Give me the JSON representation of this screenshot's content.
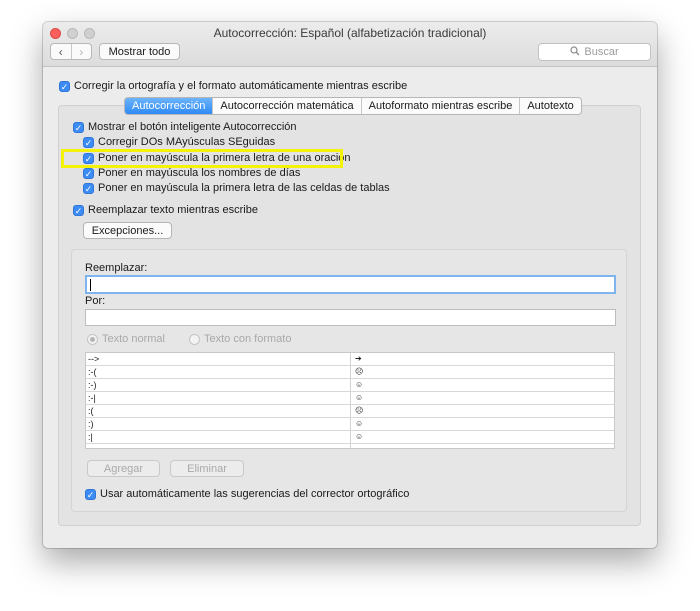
{
  "window": {
    "title": "Autocorrección: Español (alfabetización tradicional)"
  },
  "toolbar": {
    "back_icon": "chevron-left-icon",
    "forward_icon": "chevron-right-icon",
    "show_all_label": "Mostrar todo",
    "search_placeholder": "Buscar",
    "search_icon": "magnifier-icon"
  },
  "top_checkbox": {
    "label": "Corregir la ortografía y el formato automáticamente mientras escribe",
    "checked": true
  },
  "tabs": [
    {
      "label": "Autocorrección",
      "active": true
    },
    {
      "label": "Autocorrección matemática",
      "active": false
    },
    {
      "label": "Autoformato mientras escribe",
      "active": false
    },
    {
      "label": "Autotexto",
      "active": false
    }
  ],
  "options": {
    "show_smart_button": "Mostrar el botón inteligente Autocorrección",
    "correct_two_caps": "Corregir DOs MAyúsculas SEguidas",
    "capitalize_first_sentence": "Poner en mayúscula la primera letra de una oración",
    "capitalize_days": "Poner en mayúscula los nombres de días",
    "capitalize_table_cells": "Poner en mayúscula la primera letra de las celdas de tablas",
    "replace_text": "Reemplazar texto mientras escribe"
  },
  "exceptions_button": "Excepciones...",
  "replace_section": {
    "replace_label": "Reemplazar:",
    "replace_value": "",
    "with_label": "Por:",
    "with_value": "",
    "radio_plain": "Texto normal",
    "radio_formatted": "Texto con formato"
  },
  "table_rows": [
    {
      "from": "-->",
      "to": "➔"
    },
    {
      "from": ":-(",
      "to": "☹"
    },
    {
      "from": ":-)",
      "to": "☺"
    },
    {
      "from": ":-|",
      "to": "☺"
    },
    {
      "from": ":(",
      "to": "☹"
    },
    {
      "from": ":)",
      "to": "☺"
    },
    {
      "from": ":|",
      "to": "☺"
    }
  ],
  "buttons": {
    "add": "Agregar",
    "delete": "Eliminar"
  },
  "bottom_checkbox": {
    "label": "Usar automáticamente las sugerencias del corrector ortográfico",
    "checked": true
  },
  "colors": {
    "accent": "#3d8cf5",
    "highlight": "#f4f10a"
  }
}
